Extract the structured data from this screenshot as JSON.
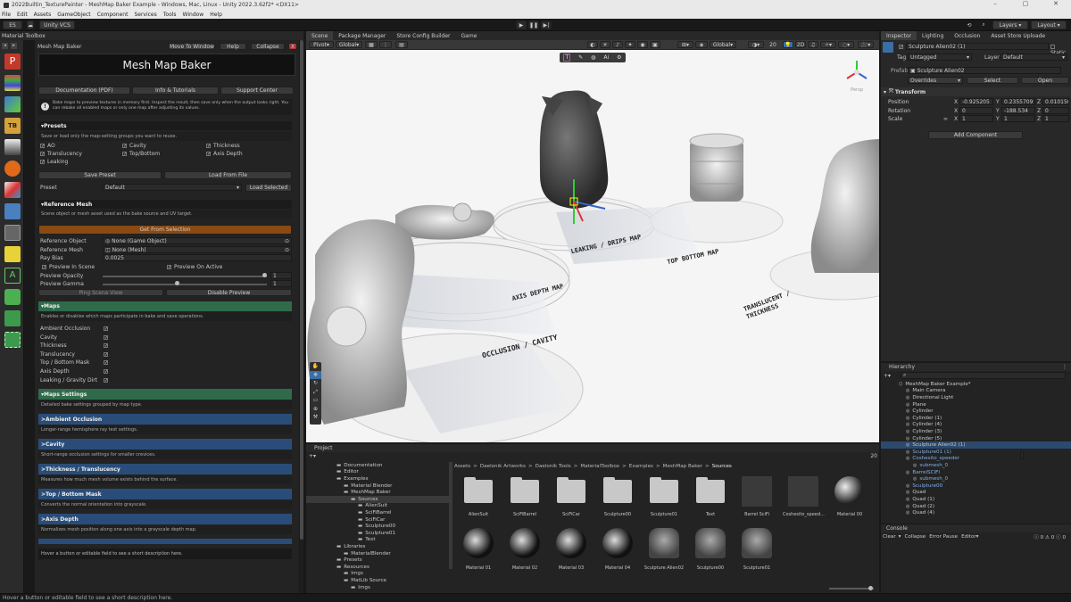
{
  "titlebar": {
    "title": "2022Builtin_TexturePainter - MeshMap Baker Example - Windows, Mac, Linux - Unity 2022.3.62f2* <DX11>"
  },
  "menu": [
    "File",
    "Edit",
    "Assets",
    "GameObject",
    "Component",
    "Services",
    "Tools",
    "Window",
    "Help"
  ],
  "toolbar": {
    "account": "ES",
    "vcs": "Unity VCS",
    "layers": "Layers",
    "layout": "Layout"
  },
  "material_toolbox": {
    "title": "Material Toolbox"
  },
  "mmb": {
    "panel_title": "Mesh Map Baker",
    "move_to_window": "Move To Window",
    "help": "Help",
    "collapse": "Collapse",
    "close": "X",
    "big_title": "Mesh Map Baker",
    "doc": "Documentation (PDF)",
    "info": "Info & Tutorials",
    "support": "Support Center",
    "info_text": "Bake maps to preview textures in memory first. Inspect the result, then save only when the output looks right. You can rebake all enabled maps or only one map after adjusting its values.",
    "presets": {
      "title": "Presets",
      "desc": "Save or load only the map-setting groups you want to reuse.",
      "checks": [
        "AO",
        "Cavity",
        "Thickness",
        "Translucency",
        "Top/Bottom",
        "Axis Depth",
        "Leaking"
      ],
      "save": "Save Preset",
      "load": "Load From File",
      "preset_label": "Preset",
      "preset_value": "Default",
      "load_selected": "Load Selected"
    },
    "ref": {
      "title": "Reference Mesh",
      "desc": "Scene object or mesh asset used as the bake source and UV target.",
      "get": "Get From Selection",
      "obj_label": "Reference Object",
      "obj_value": "None (Game Object)",
      "mesh_label": "Reference Mesh",
      "mesh_value": "None (Mesh)",
      "bias_label": "Ray Bias",
      "bias_value": "0.0025",
      "preview_scene": "Preview In Scene",
      "preview_active": "Preview On Active",
      "opacity_label": "Preview Opacity",
      "opacity_value": "1",
      "opacity_fraction": 1.0,
      "gamma_label": "Preview Gamma",
      "gamma_value": "1",
      "gamma_fraction": 0.45,
      "ping": "Ping Scene View",
      "disable": "Disable Preview"
    },
    "maps": {
      "title": "Maps",
      "desc": "Enables or disables which maps participate in bake and save operations.",
      "items": [
        "Ambient Occlusion",
        "Cavity",
        "Thickness",
        "Translucency",
        "Top / Bottom Mask",
        "Axis Depth",
        "Leaking / Gravity Dirt"
      ]
    },
    "maps_settings": {
      "title": "Maps Settings",
      "desc": "Detailed bake settings grouped by map type."
    },
    "groups": [
      {
        "title": "Ambient Occlusion",
        "desc": "Longer-range hemisphere ray test settings."
      },
      {
        "title": "Cavity",
        "desc": "Short-range occlusion settings for smaller crevices."
      },
      {
        "title": "Thickness / Translucency",
        "desc": "Measures how much mesh volume exists behind the surface."
      },
      {
        "title": "Top / Bottom Mask",
        "desc": "Converts the normal orientation into grayscale."
      },
      {
        "title": "Axis Depth",
        "desc": "Normalizes mesh position along one axis into a grayscale depth map."
      }
    ],
    "footer_hint": "Hover a button or editable field to see a short description here."
  },
  "scene": {
    "tabs": [
      "Scene",
      "Package Manager",
      "Store Config Builder",
      "Game"
    ],
    "pivot": "Pivot",
    "global": "Global",
    "global2": "Global",
    "num": "20",
    "labels": [
      "LEAKING / DRIPS MAP",
      "TOP BOTTOM MAP",
      "AXIS DEPTH MAP",
      "TRANSLUCENT / THICKNESS",
      "OCCLUSION / CAVITY"
    ],
    "persp": "Persp"
  },
  "inspector": {
    "tabs": [
      "Inspector",
      "Lighting",
      "Occlusion",
      "Asset Store Uploade"
    ],
    "name": "Sculpture Alien02 (1)",
    "static": "Static",
    "tag_label": "Tag",
    "tag": "Untagged",
    "layer_label": "Layer",
    "layer": "Default",
    "prefab_label": "Prefab",
    "prefab": "Sculpture Alien02",
    "overrides": "Overrides",
    "select": "Select",
    "open": "Open",
    "transform": "Transform",
    "position": {
      "label": "Position",
      "x": "-0.925205",
      "y": "0.2355709",
      "z": "0.0101561"
    },
    "rotation": {
      "label": "Rotation",
      "x": "0",
      "y": "-188.534",
      "z": "0"
    },
    "scale": {
      "label": "Scale",
      "x": "1",
      "y": "1",
      "z": "1"
    },
    "add_component": "Add Component"
  },
  "hierarchy": {
    "title": "Hierarchy",
    "items": [
      {
        "t": "MeshMap Baker Example*",
        "d": 0,
        "sel": false
      },
      {
        "t": "Main Camera",
        "d": 1,
        "sel": false
      },
      {
        "t": "Directional Light",
        "d": 1,
        "sel": false
      },
      {
        "t": "Plane",
        "d": 1,
        "sel": false
      },
      {
        "t": "Cylinder",
        "d": 1,
        "sel": false
      },
      {
        "t": "Cylinder (1)",
        "d": 1,
        "sel": false
      },
      {
        "t": "Cylinder (4)",
        "d": 1,
        "sel": false
      },
      {
        "t": "Cylinder (3)",
        "d": 1,
        "sel": false
      },
      {
        "t": "Cylinder (5)",
        "d": 1,
        "sel": false
      },
      {
        "t": "Sculpture Alien02 (1)",
        "d": 1,
        "sel": true
      },
      {
        "t": "Sculpture01 (1)",
        "d": 1,
        "sel": false,
        "blue": true
      },
      {
        "t": "Coshesito_speeder",
        "d": 1,
        "sel": false,
        "blue": true
      },
      {
        "t": "submesh_0",
        "d": 2,
        "sel": false,
        "blue": true
      },
      {
        "t": "BarrelSCIFI",
        "d": 1,
        "sel": false,
        "blue": true
      },
      {
        "t": "submesh_0",
        "d": 2,
        "sel": false,
        "blue": true
      },
      {
        "t": "Sculpture00",
        "d": 1,
        "sel": false,
        "blue": true
      },
      {
        "t": "Quad",
        "d": 1,
        "sel": false
      },
      {
        "t": "Quad (1)",
        "d": 1,
        "sel": false
      },
      {
        "t": "Quad (2)",
        "d": 1,
        "sel": false
      },
      {
        "t": "Quad (4)",
        "d": 1,
        "sel": false
      }
    ]
  },
  "console": {
    "title": "Console",
    "clear": "Clear",
    "collapse": "Collapse",
    "error_pause": "Error Pause",
    "editor": "Editor",
    "c1": "0",
    "c2": "0",
    "c3": "0"
  },
  "project": {
    "title": "Project",
    "count": "20",
    "breadcrumb": [
      "Assets",
      "Daelonik Artworks",
      "Daelonik Tools",
      "MaterialToolbox",
      "Examples",
      "MeshMap Baker",
      "Sources"
    ],
    "tree": [
      {
        "t": "Documentation",
        "d": 1
      },
      {
        "t": "Editor",
        "d": 1
      },
      {
        "t": "Examples",
        "d": 1
      },
      {
        "t": "Material Blender",
        "d": 2
      },
      {
        "t": "MeshMap Baker",
        "d": 2
      },
      {
        "t": "Sources",
        "d": 3,
        "sel": true
      },
      {
        "t": "AlienSuit",
        "d": 4
      },
      {
        "t": "SciFiBarrel",
        "d": 4
      },
      {
        "t": "SciFiCar",
        "d": 4
      },
      {
        "t": "Sculpture00",
        "d": 4
      },
      {
        "t": "Sculpture01",
        "d": 4
      },
      {
        "t": "Text",
        "d": 4
      },
      {
        "t": "Libraries",
        "d": 1
      },
      {
        "t": "MaterialBlender",
        "d": 2
      },
      {
        "t": "Presets",
        "d": 1
      },
      {
        "t": "Resources",
        "d": 1
      },
      {
        "t": "Imgs",
        "d": 2
      },
      {
        "t": "MatLib Source",
        "d": 2
      },
      {
        "t": "Imgs",
        "d": 3
      }
    ],
    "row1": [
      "AlienSuit",
      "SciFiBarrel",
      "SciFiCar",
      "Sculpture00",
      "Sculpture01",
      "Text",
      "Barrel SciFi",
      "Coshesito_speed...",
      "Material 00"
    ],
    "row2": [
      "Material 01",
      "Material 02",
      "Material 03",
      "Material 04",
      "Sculpture Alien02",
      "Sculpture00",
      "Sculpture01"
    ]
  },
  "status": {
    "text": "Hover a button or editable field to see a short description here."
  }
}
